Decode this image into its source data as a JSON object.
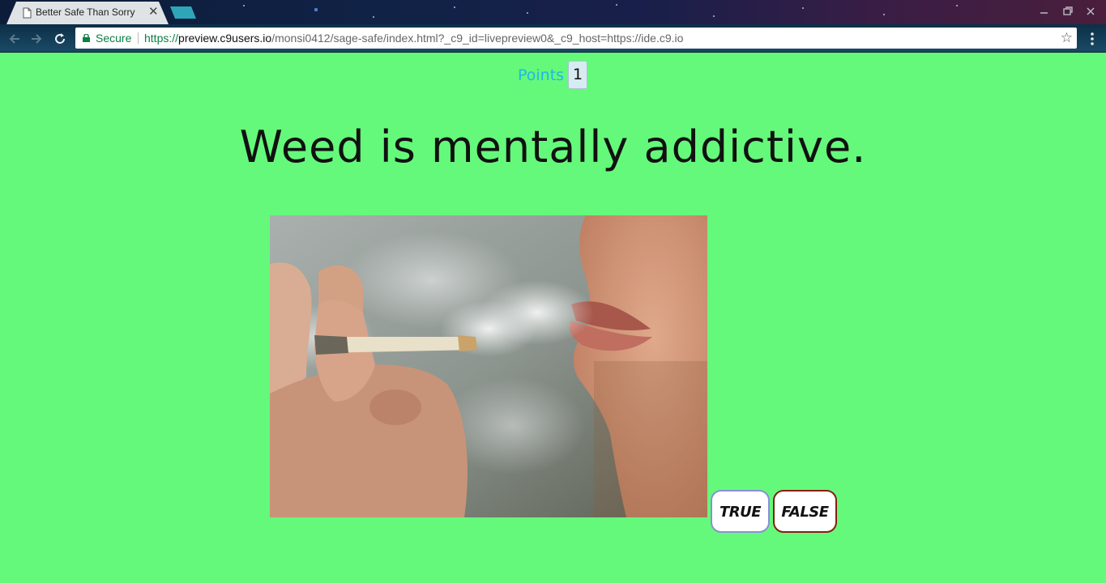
{
  "browser": {
    "tab_title": "Better Safe Than Sorry",
    "tab_close": "✕",
    "secure_label": "Secure",
    "url_scheme": "https://",
    "url_host": "preview.c9users.io",
    "url_path": "/monsi0412/sage-safe/index.html?_c9_id=livepreview0&_c9_host=https://ide.c9.io",
    "icons": [
      "page-icon",
      "back-icon",
      "forward-icon",
      "reload-icon",
      "lock-icon",
      "star-icon",
      "menu-icon",
      "minimize-icon",
      "restore-icon",
      "close-icon"
    ]
  },
  "game": {
    "points_label": "Points",
    "points_value": "1",
    "question": "Weed is mentally addictive.",
    "true_label": "TRUE",
    "false_label": "FALSE"
  },
  "colors": {
    "page_background": "#64f97a",
    "points_label": "#1fb8e6",
    "true_border": "#8a8fd6",
    "false_border": "#8a1c12",
    "secure_green": "#0b8043"
  }
}
